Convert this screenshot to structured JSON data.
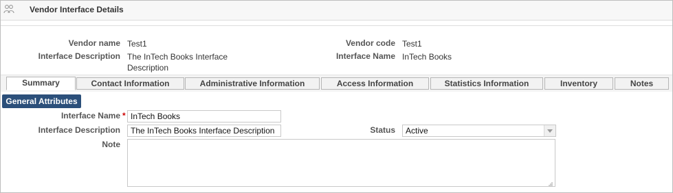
{
  "page": {
    "title": "Vendor Interface Details"
  },
  "header": {
    "vendor_name_label": "Vendor name",
    "vendor_name_value": "Test1",
    "vendor_code_label": "Vendor code",
    "vendor_code_value": "Test1",
    "interface_description_label": "Interface Description",
    "interface_description_line1": "The InTech Books Interface",
    "interface_description_line2": "Description",
    "interface_name_label": "Interface Name",
    "interface_name_value": "InTech Books"
  },
  "tabs": [
    {
      "label": "Summary",
      "active": true
    },
    {
      "label": "Contact Information"
    },
    {
      "label": "Administrative Information"
    },
    {
      "label": "Access Information"
    },
    {
      "label": "Statistics Information"
    },
    {
      "label": "Inventory"
    },
    {
      "label": "Notes"
    }
  ],
  "section": {
    "title": "General Attributes"
  },
  "form": {
    "interface_name_label": "Interface Name",
    "required_marker": "*",
    "interface_name_value": "InTech Books",
    "interface_description_label": "Interface Description",
    "interface_description_value": "The InTech Books Interface Description",
    "status_label": "Status",
    "status_value": "Active",
    "note_label": "Note",
    "note_value": ""
  }
}
